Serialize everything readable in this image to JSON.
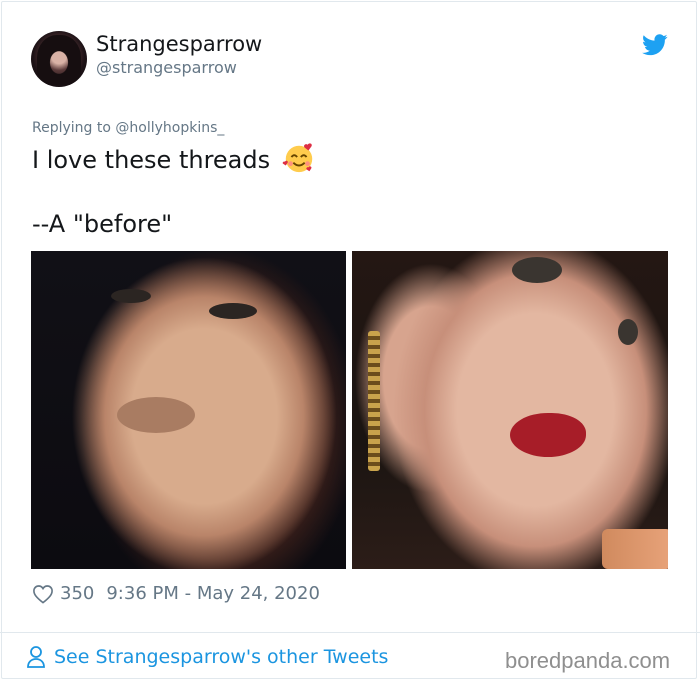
{
  "author": {
    "name": "Strangesparrow",
    "handle": "@strangesparrow",
    "avatar_icon": "profile-photo"
  },
  "platform_icon": "twitter-bird-icon",
  "reply": {
    "prefix": "Replying to ",
    "mention": "@hollyhopkins_"
  },
  "tweet": {
    "line1": "I love these threads",
    "line1_emoji": "smiling-face-with-hearts",
    "line2": "--A \"before\""
  },
  "media": {
    "left_photo": "selfie-before",
    "right_photo": "selfie-after"
  },
  "meta": {
    "likes": "350",
    "timestamp": "9:36 PM - May 24, 2020"
  },
  "footer": {
    "link_text": "See Strangesparrow's other Tweets",
    "watermark": "boredpanda.com"
  },
  "colors": {
    "link": "#1b95e0",
    "muted": "#657786",
    "text": "#14171a",
    "twitter_blue": "#1da1f2"
  }
}
